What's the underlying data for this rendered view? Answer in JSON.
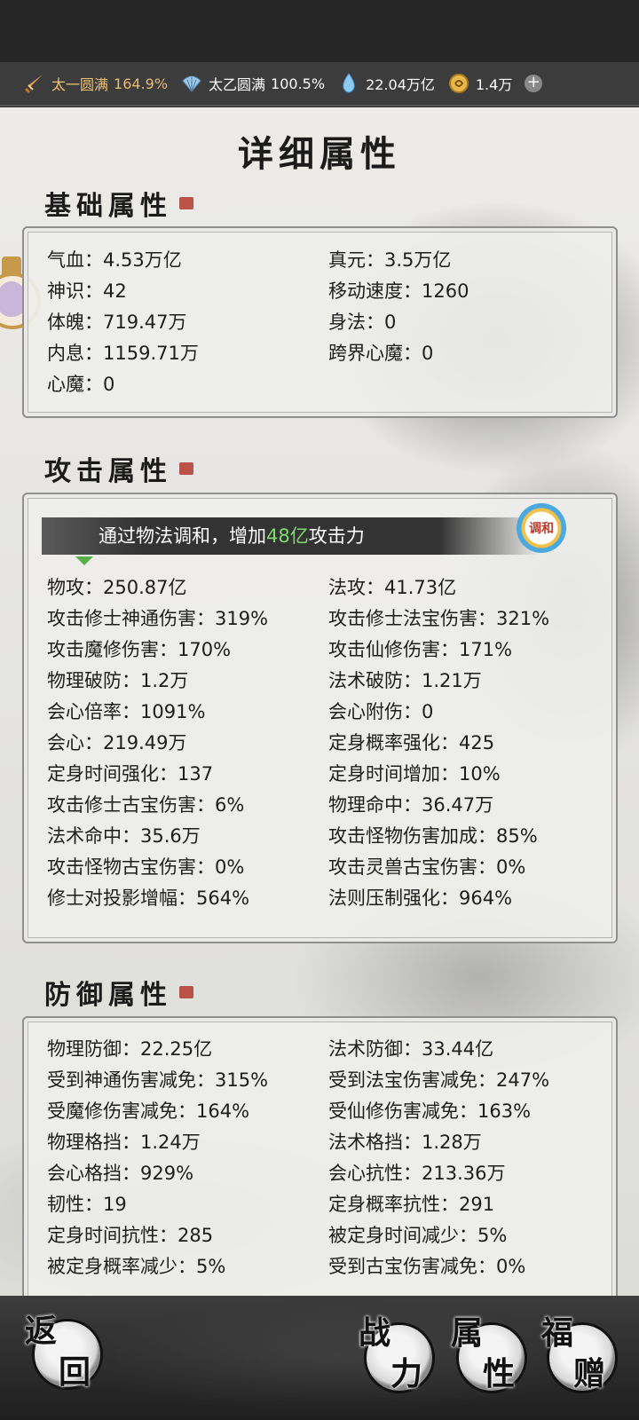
{
  "resources": [
    {
      "name": "太一圆满",
      "value": "164.9%",
      "icon": "sword-icon"
    },
    {
      "name": "太乙圆满",
      "value": "100.5%",
      "icon": "fan-icon"
    },
    {
      "name": "",
      "value": "22.04万亿",
      "icon": "droplet-icon"
    },
    {
      "name": "",
      "value": "1.4万",
      "icon": "coin-icon"
    }
  ],
  "page_title": "详细属性",
  "basic": {
    "title": "基础属性",
    "rows": [
      [
        "气血：4.53万亿",
        "真元：3.5万亿"
      ],
      [
        "神识：42",
        "移动速度：1260"
      ],
      [
        "体魄：719.47万",
        "身法：0"
      ],
      [
        "内息：1159.71万",
        "跨界心魔：0"
      ],
      [
        "心魔：0",
        ""
      ]
    ]
  },
  "attack": {
    "title": "攻击属性",
    "banner_prefix": "通过物法调和，增加",
    "banner_highlight": "48亿",
    "banner_suffix": "攻击力",
    "harmonize_label": "调和",
    "rows": [
      [
        "物攻：250.87亿",
        "法攻：41.73亿"
      ],
      [
        "攻击修士神通伤害：319%",
        "攻击修士法宝伤害：321%"
      ],
      [
        "攻击魔修伤害：170%",
        "攻击仙修伤害：171%"
      ],
      [
        "物理破防：1.2万",
        "法术破防：1.21万"
      ],
      [
        "会心倍率：1091%",
        "会心附伤：0"
      ],
      [
        "会心：219.49万",
        "定身概率强化：425"
      ],
      [
        "定身时间强化：137",
        "定身时间增加：10%"
      ],
      [
        "攻击修士古宝伤害：6%",
        "物理命中：36.47万"
      ],
      [
        "法术命中：35.6万",
        "攻击怪物伤害加成：85%"
      ],
      [
        "攻击怪物古宝伤害：0%",
        "攻击灵兽古宝伤害：0%"
      ],
      [
        "修士对投影增幅：564%",
        "法则压制强化：964%"
      ]
    ]
  },
  "defense": {
    "title": "防御属性",
    "rows": [
      [
        "物理防御：22.25亿",
        "法术防御：33.44亿"
      ],
      [
        "受到神通伤害减免：315%",
        "受到法宝伤害减免：247%"
      ],
      [
        "受魔修伤害减免：164%",
        "受仙修伤害减免：163%"
      ],
      [
        "物理格挡：1.24万",
        "法术格挡：1.28万"
      ],
      [
        "会心格挡：929%",
        "会心抗性：213.36万"
      ],
      [
        "韧性：19",
        "定身概率抗性：291"
      ],
      [
        "定身时间抗性：285",
        "被定身时间减少：5%"
      ],
      [
        "被定身概率减少：5%",
        "受到古宝伤害减免：0%"
      ]
    ]
  },
  "buttons": {
    "back": [
      "返",
      "回"
    ],
    "combat": [
      "战",
      "力"
    ],
    "attributes": [
      "属",
      "性"
    ],
    "gift": [
      "福",
      "赠"
    ]
  }
}
